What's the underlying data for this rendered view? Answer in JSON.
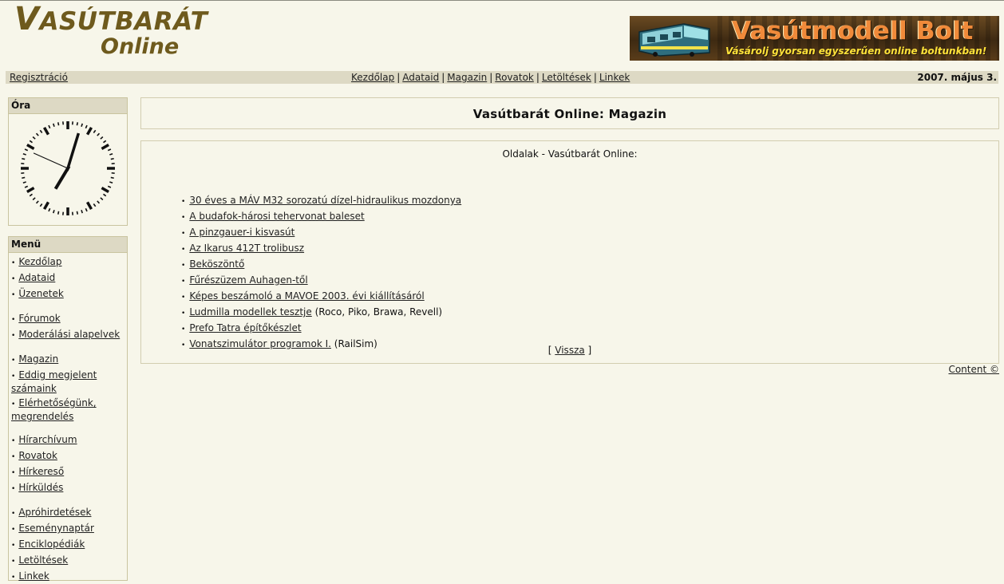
{
  "header": {
    "logo_line1_cap": "V",
    "logo_line1_rest": "ASÚTBARÁT",
    "logo_line2": "Online",
    "banner_title": "Vasútmodell Bolt",
    "banner_subtitle": "Vásárolj gyorsan egyszerűen online boltunkban!"
  },
  "navbar": {
    "registration": "Regisztráció",
    "links": [
      "Kezdőlap",
      "Adataid",
      "Magazin",
      "Rovatok",
      "Letöltések",
      "Linkek"
    ],
    "separator": "|",
    "date": "2007. május 3."
  },
  "clock": {
    "title": "Óra",
    "hour": 7,
    "minute": 2,
    "second": 49
  },
  "menu": {
    "title": "Menü",
    "groups": [
      [
        "Kezdőlap",
        "Adataid",
        "Üzenetek"
      ],
      [
        "Fórumok",
        "Moderálási alapelvek"
      ],
      [
        "Magazin",
        "Eddig megjelent számaink",
        "Elérhetőségünk, megrendelés"
      ],
      [
        "Hírarchívum",
        "Rovatok",
        "Hírkereső",
        "Hírküldés"
      ],
      [
        "Apróhirdetések",
        "Eseménynaptár",
        "Enciklopédiák",
        "Letöltések",
        "Linkek"
      ]
    ]
  },
  "main": {
    "title": "Vasútbarát Online: Magazin",
    "subtitle": "Oldalak - Vasútbarát Online:",
    "articles": [
      {
        "link": "30 éves a MÁV M32 sorozatú dízel-hidraulikus mozdonya",
        "extra": ""
      },
      {
        "link": "A budafok-hárosi tehervonat baleset",
        "extra": ""
      },
      {
        "link": "A pinzgauer-i kisvasút",
        "extra": ""
      },
      {
        "link": "Az Ikarus 412T trolibusz",
        "extra": ""
      },
      {
        "link": "Beköszöntő",
        "extra": ""
      },
      {
        "link": "Fűrészüzem Auhagen-től",
        "extra": ""
      },
      {
        "link": "Képes beszámoló a MAVOE 2003. évi kiállításáról",
        "extra": ""
      },
      {
        "link": "Ludmilla modellek tesztje",
        "extra": " (Roco, Piko, Brawa, Revell)"
      },
      {
        "link": "Prefo Tatra építőkészlet",
        "extra": ""
      },
      {
        "link": "Vonatszimulátor programok I.",
        "extra": " (RailSim)"
      }
    ],
    "back_open": "[ ",
    "back_label": "Vissza",
    "back_close": " ]"
  },
  "footer": {
    "content_link": "Content ©"
  },
  "colors": {
    "background": "#f7f6ea",
    "bar": "#ddd9c4",
    "logo": "#6e5a1d",
    "banner_title": "#f08a3a",
    "banner_subtitle": "#ffe33a"
  }
}
